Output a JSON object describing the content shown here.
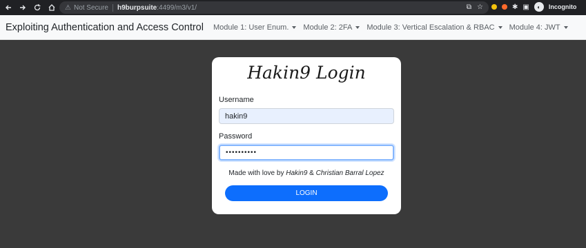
{
  "browser": {
    "not_secure": "Not Secure",
    "host": "h9burpsuite",
    "path": ":4499/m3/v1/",
    "incognito": "Incognito"
  },
  "navbar": {
    "brand": "Exploiting Authentication and Access Control",
    "items": [
      {
        "label": "Module 1: User Enum."
      },
      {
        "label": "Module 2: 2FA"
      },
      {
        "label": "Module 3: Vertical Escalation & RBAC"
      },
      {
        "label": "Module 4: JWT"
      }
    ]
  },
  "login": {
    "title": "Hakin9 Login",
    "username_label": "Username",
    "username_value": "hakin9",
    "password_label": "Password",
    "password_value": "••••••••••",
    "credits_prefix": "Made with love by ",
    "credits_author1": "Hakin9",
    "credits_and": " & ",
    "credits_author2": "Christian Barral Lopez",
    "button_label": "LOGIN"
  },
  "colors": {
    "background": "#3a3a3a",
    "primary": "#0d6efd",
    "navbar_bg": "#f8f9fa"
  }
}
